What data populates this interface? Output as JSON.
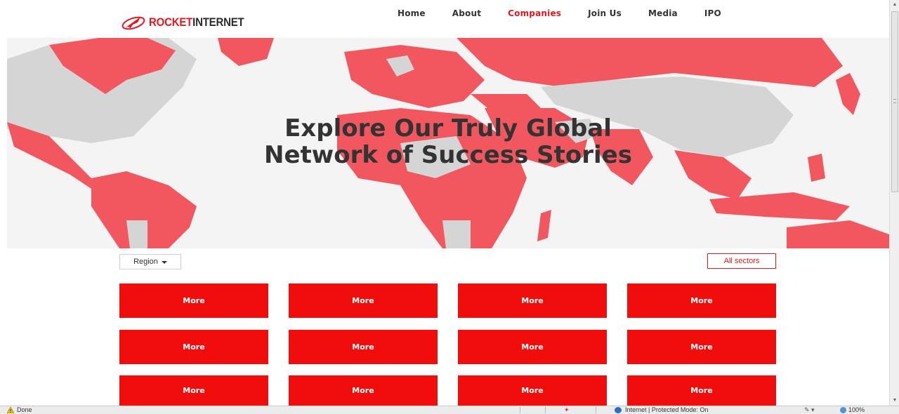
{
  "brand": {
    "part1": "ROCKET",
    "part2": "INTERNET",
    "red": "#e4171f"
  },
  "nav": [
    {
      "label": "Home",
      "active": false
    },
    {
      "label": "About",
      "active": false
    },
    {
      "label": "Companies",
      "active": true
    },
    {
      "label": "Join Us",
      "active": false
    },
    {
      "label": "Media",
      "active": false
    },
    {
      "label": "IPO",
      "active": false
    }
  ],
  "hero": {
    "title_line1": "Explore Our Truly Global",
    "title_line2": "Network of Success Stories"
  },
  "filters": {
    "region_label": "Region",
    "sector_label": "All sectors"
  },
  "cards": [
    {
      "label": "More"
    },
    {
      "label": "More"
    },
    {
      "label": "More"
    },
    {
      "label": "More"
    },
    {
      "label": "More"
    },
    {
      "label": "More"
    },
    {
      "label": "More"
    },
    {
      "label": "More"
    },
    {
      "label": "More"
    },
    {
      "label": "More"
    },
    {
      "label": "More"
    },
    {
      "label": "More"
    }
  ],
  "statusbar": {
    "status": "Done",
    "zone": "Internet | Protected Mode: On",
    "zoom": "100%"
  },
  "colors": {
    "accent": "#e4171f",
    "card": "#f20d0d",
    "map_land_highlight": "#f2565e",
    "map_land": "#d5d5d5"
  }
}
